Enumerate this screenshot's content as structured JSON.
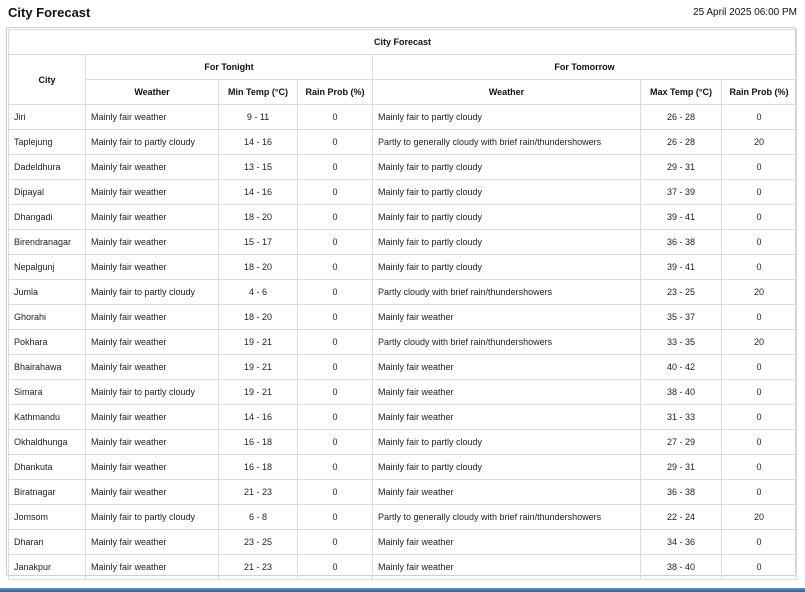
{
  "header": {
    "title": "City Forecast",
    "datetime": "25 April 2025 06:00 PM"
  },
  "table": {
    "caption": "City Forecast",
    "city_header": "City",
    "groups": {
      "tonight": "For Tonight",
      "tomorrow": "For Tomorrow"
    },
    "columns": {
      "tonight_weather": "Weather",
      "min_temp": "Min Temp (°C)",
      "tonight_rain": "Rain Prob (%)",
      "tomorrow_weather": "Weather",
      "max_temp": "Max Temp (°C)",
      "tomorrow_rain": "Rain Prob (%)"
    },
    "rows": [
      [
        "Jiri",
        "Mainly fair weather",
        "9 - 11",
        "0",
        "Mainly fair to partly cloudy",
        "26 - 28",
        "0"
      ],
      [
        "Taplejung",
        "Mainly fair to partly cloudy",
        "14 - 16",
        "0",
        "Partly to generally cloudy with brief rain/thundershowers",
        "26 - 28",
        "20"
      ],
      [
        "Dadeldhura",
        "Mainly fair weather",
        "13 - 15",
        "0",
        "Mainly fair to partly cloudy",
        "29 - 31",
        "0"
      ],
      [
        "Dipayal",
        "Mainly fair weather",
        "14 - 16",
        "0",
        "Mainly fair to partly cloudy",
        "37 - 39",
        "0"
      ],
      [
        "Dhangadi",
        "Mainly fair weather",
        "18 - 20",
        "0",
        "Mainly fair to partly cloudy",
        "39 - 41",
        "0"
      ],
      [
        "Birendranagar",
        "Mainly fair weather",
        "15 - 17",
        "0",
        "Mainly fair to partly cloudy",
        "36 - 38",
        "0"
      ],
      [
        "Nepalgunj",
        "Mainly fair weather",
        "18 - 20",
        "0",
        "Mainly fair to partly cloudy",
        "39 - 41",
        "0"
      ],
      [
        "Jumla",
        "Mainly fair to partly cloudy",
        "4 - 6",
        "0",
        "Partly cloudy with brief rain/thundershowers",
        "23 - 25",
        "20"
      ],
      [
        "Ghorahi",
        "Mainly fair weather",
        "18 - 20",
        "0",
        "Mainly fair weather",
        "35 - 37",
        "0"
      ],
      [
        "Pokhara",
        "Mainly fair weather",
        "19 - 21",
        "0",
        "Partly cloudy with brief rain/thundershowers",
        "33 - 35",
        "20"
      ],
      [
        "Bhairahawa",
        "Mainly fair weather",
        "19 - 21",
        "0",
        "Mainly fair weather",
        "40 - 42",
        "0"
      ],
      [
        "Simara",
        "Mainly fair to partly cloudy",
        "19 - 21",
        "0",
        "Mainly fair weather",
        "38 - 40",
        "0"
      ],
      [
        "Kathmandu",
        "Mainly fair weather",
        "14 - 16",
        "0",
        "Mainly fair weather",
        "31 - 33",
        "0"
      ],
      [
        "Okhaldhunga",
        "Mainly fair weather",
        "16 - 18",
        "0",
        "Mainly fair to partly cloudy",
        "27 - 29",
        "0"
      ],
      [
        "Dhankuta",
        "Mainly fair weather",
        "16 - 18",
        "0",
        "Mainly fair to partly cloudy",
        "29 - 31",
        "0"
      ],
      [
        "Biratnagar",
        "Mainly fair weather",
        "21 - 23",
        "0",
        "Mainly fair weather",
        "36 - 38",
        "0"
      ],
      [
        "Jomsom",
        "Mainly fair to partly cloudy",
        "6 - 8",
        "0",
        "Partly to generally cloudy with brief rain/thundershowers",
        "22 - 24",
        "20"
      ],
      [
        "Dharan",
        "Mainly fair weather",
        "23 - 25",
        "0",
        "Mainly fair weather",
        "34 - 36",
        "0"
      ],
      [
        "Janakpur",
        "Mainly fair weather",
        "21 - 23",
        "0",
        "Mainly fair weather",
        "38 - 40",
        "0"
      ]
    ]
  }
}
